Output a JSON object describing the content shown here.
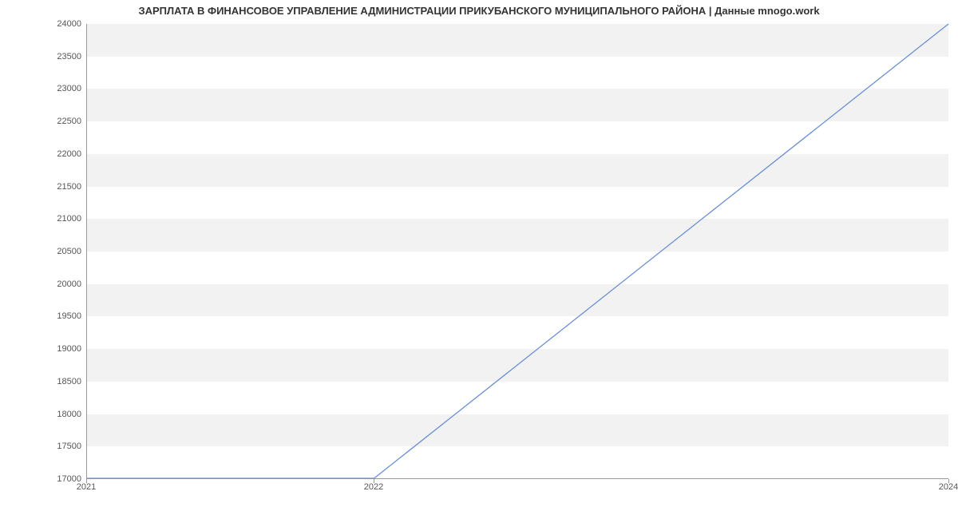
{
  "chart_data": {
    "type": "line",
    "title": "ЗАРПЛАТА В ФИНАНСОВОЕ УПРАВЛЕНИЕ АДМИНИСТРАЦИИ ПРИКУБАНСКОГО МУНИЦИПАЛЬНОГО РАЙОНА | Данные mnogo.work",
    "x": [
      2021,
      2022,
      2024
    ],
    "values": [
      17000,
      17000,
      24000
    ],
    "xlabel": "",
    "ylabel": "",
    "xlim": [
      2021,
      2024
    ],
    "ylim": [
      17000,
      24000
    ],
    "x_ticks": [
      2021,
      2022,
      2024
    ],
    "y_ticks": [
      17000,
      17500,
      18000,
      18500,
      19000,
      19500,
      20000,
      20500,
      21000,
      21500,
      22000,
      22500,
      23000,
      23500,
      24000
    ],
    "line_color": "#6b8fd4",
    "stripe_color": "#f2f2f2"
  }
}
